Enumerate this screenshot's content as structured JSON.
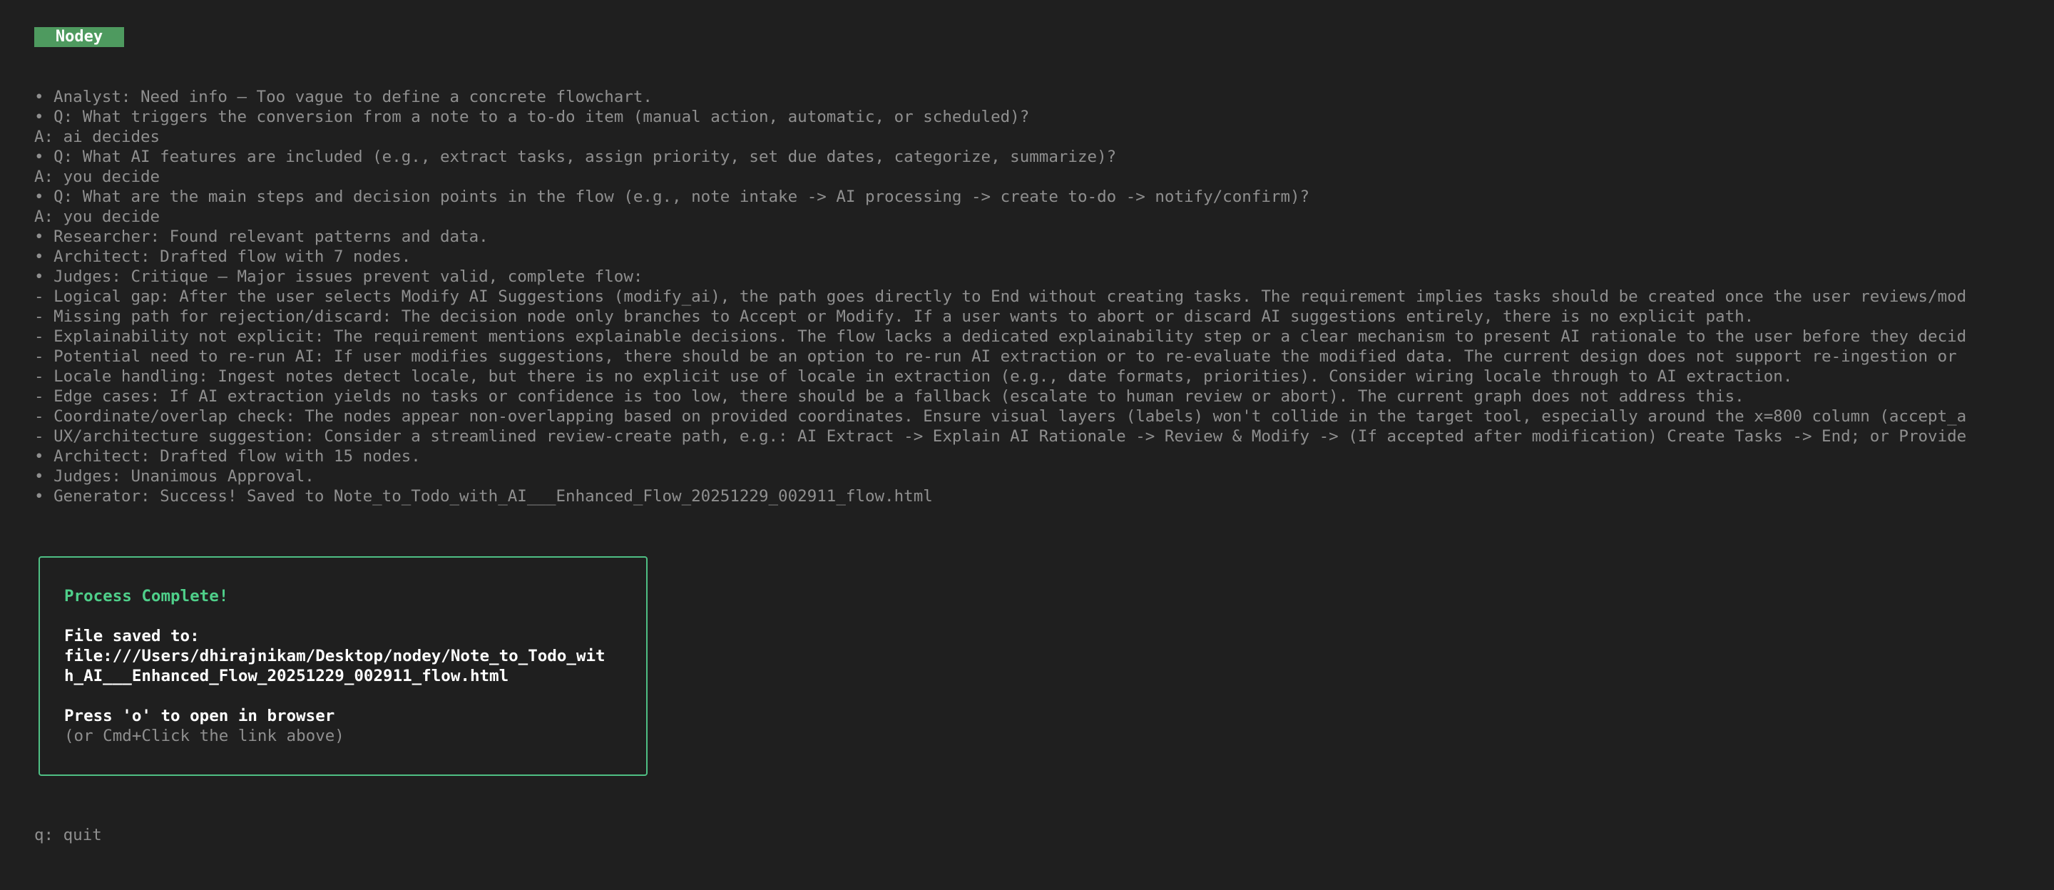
{
  "app": {
    "title": " Nodey "
  },
  "log": [
    "• Analyst: Need info — Too vague to define a concrete flowchart.",
    "• Q: What triggers the conversion from a note to a to-do item (manual action, automatic, or scheduled)?",
    "A: ai decides",
    "• Q: What AI features are included (e.g., extract tasks, assign priority, set due dates, categorize, summarize)?",
    "A: you decide",
    "• Q: What are the main steps and decision points in the flow (e.g., note intake -> AI processing -> create to-do -> notify/confirm)?",
    "A: you decide",
    "• Researcher: Found relevant patterns and data.",
    "• Architect: Drafted flow with 7 nodes.",
    "• Judges: Critique — Major issues prevent valid, complete flow:",
    "- Logical gap: After the user selects Modify AI Suggestions (modify_ai), the path goes directly to End without creating tasks. The requirement implies tasks should be created once the user reviews/mod",
    "- Missing path for rejection/discard: The decision node only branches to Accept or Modify. If a user wants to abort or discard AI suggestions entirely, there is no explicit path.",
    "- Explainability not explicit: The requirement mentions explainable decisions. The flow lacks a dedicated explainability step or a clear mechanism to present AI rationale to the user before they decid",
    "- Potential need to re-run AI: If user modifies suggestions, there should be an option to re-run AI extraction or to re-evaluate the modified data. The current design does not support re-ingestion or",
    "- Locale handling: Ingest notes detect locale, but there is no explicit use of locale in extraction (e.g., date formats, priorities). Consider wiring locale through to AI extraction.",
    "- Edge cases: If AI extraction yields no tasks or confidence is too low, there should be a fallback (escalate to human review or abort). The current graph does not address this.",
    "- Coordinate/overlap check: The nodes appear non-overlapping based on provided coordinates. Ensure visual layers (labels) won't collide in the target tool, especially around the x=800 column (accept_a",
    "- UX/architecture suggestion: Consider a streamlined review-create path, e.g.: AI Extract -> Explain AI Rationale -> Review & Modify -> (If accepted after modification) Create Tasks -> End; or Provide",
    "• Architect: Drafted flow with 15 nodes.",
    "• Judges: Unanimous Approval.",
    "• Generator: Success! Saved to Note_to_Todo_with_AI___Enhanced_Flow_20251229_002911_flow.html"
  ],
  "panel": {
    "title": "Process Complete!",
    "saved_label": "File saved to:",
    "path_line1": "file:///Users/dhirajnikam/Desktop/nodey/Note_to_Todo_wit",
    "path_line2": "h_AI___Enhanced_Flow_20251229_002911_flow.html",
    "open_hint": "Press 'o' to open in browser",
    "alt_hint": "(or Cmd+Click the link above)"
  },
  "footer": {
    "quit_hint": "q: quit"
  },
  "colors": {
    "background": "#1f1f1f",
    "badge": "#4e9a5f",
    "accent_green": "#4fcf8a",
    "border_green": "#4fbf84",
    "dim_text": "#8f8f8f"
  }
}
